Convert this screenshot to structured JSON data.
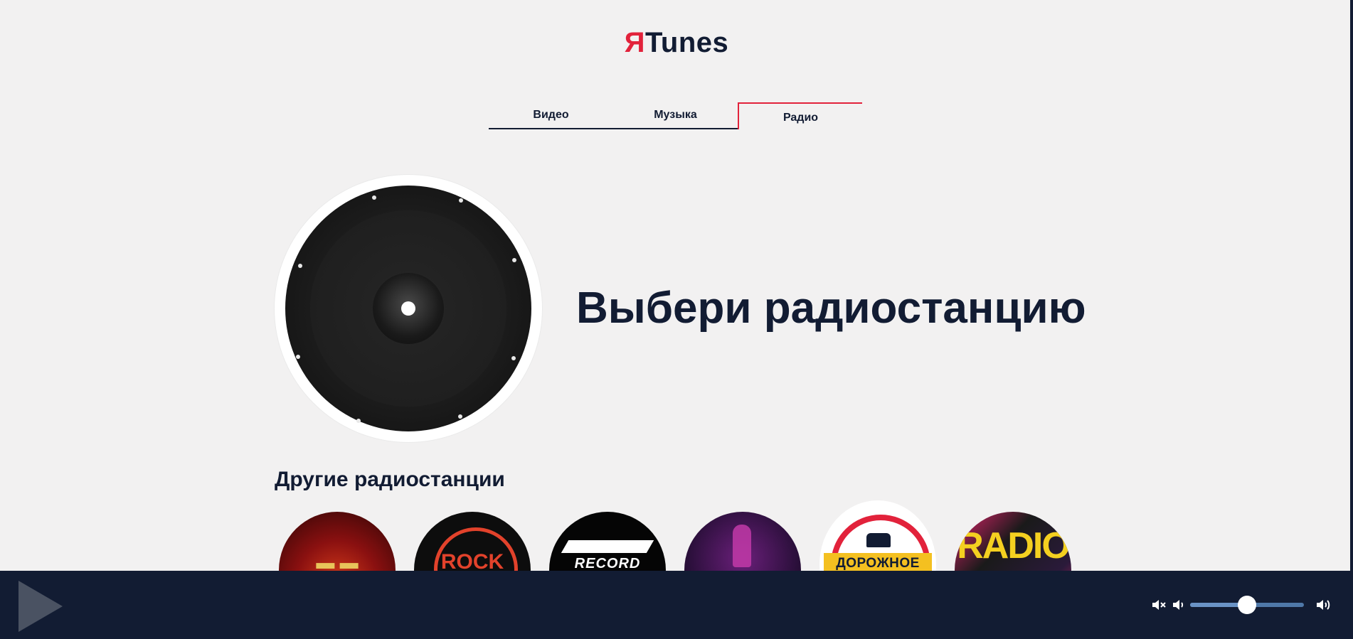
{
  "app": {
    "logo_prefix": "Я",
    "logo_suffix": "Tunes"
  },
  "tabs": [
    {
      "label": "Видео",
      "active": false
    },
    {
      "label": "Музыка",
      "active": false
    },
    {
      "label": "Радио",
      "active": true
    }
  ],
  "hero": {
    "title": "Выбери радиостанцию"
  },
  "section": {
    "title": "Другие радиостанции"
  },
  "stations": [
    {
      "label": "",
      "bg": "#7a0f0f"
    },
    {
      "label": "ROCK",
      "bg": "#0d0d0d"
    },
    {
      "label": "RECORD",
      "bg": "#050505"
    },
    {
      "label": "",
      "bg": "#2a0f3a"
    },
    {
      "label": "ДОРОЖНОЕ",
      "bg": "#ffffff"
    },
    {
      "label": "RADIO",
      "bg": "#1a1a1a"
    }
  ],
  "player": {
    "volume_level": 0.5
  },
  "colors": {
    "accent": "#e2223b",
    "navy": "#121c33",
    "slider": "#4f78a8"
  }
}
